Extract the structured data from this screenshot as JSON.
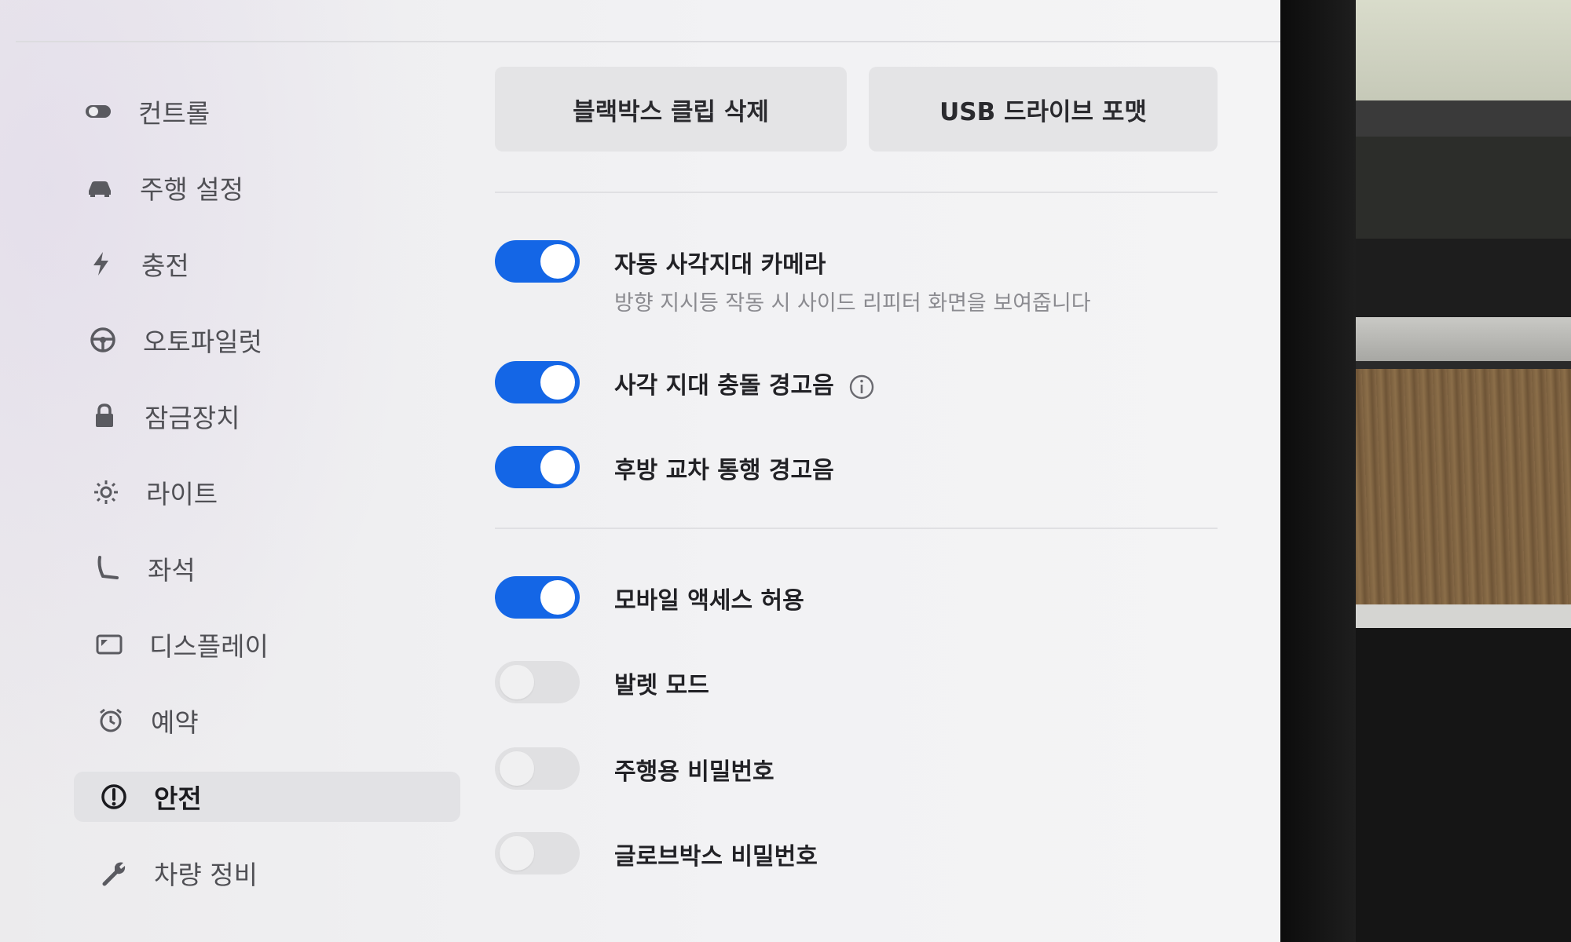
{
  "sidebar": {
    "items": [
      {
        "label": "컨트롤",
        "icon": "toggle-icon"
      },
      {
        "label": "주행 설정",
        "icon": "car-icon"
      },
      {
        "label": "충전",
        "icon": "lightning-icon"
      },
      {
        "label": "오토파일럿",
        "icon": "steering-wheel-icon"
      },
      {
        "label": "잠금장치",
        "icon": "lock-icon"
      },
      {
        "label": "라이트",
        "icon": "light-icon"
      },
      {
        "label": "좌석",
        "icon": "seat-icon"
      },
      {
        "label": "디스플레이",
        "icon": "display-icon"
      },
      {
        "label": "예약",
        "icon": "alarm-clock-icon"
      },
      {
        "label": "안전",
        "icon": "alert-circle-icon",
        "active": true
      },
      {
        "label": "차량 정비",
        "icon": "wrench-icon"
      }
    ]
  },
  "actions": {
    "delete_clips": "블랙박스 클립 삭제",
    "format_usb": "USB 드라이브 포맷"
  },
  "settings": [
    {
      "label": "자동 사각지대 카메라",
      "description": "방향 지시등 작동 시 사이드 리피터 화면을 보여줍니다",
      "on": true
    },
    {
      "label": "사각 지대 충돌 경고음",
      "on": true,
      "info": true
    },
    {
      "label": "후방 교차 통행 경고음",
      "on": true
    },
    {
      "label": "모바일 액세스 허용",
      "on": true
    },
    {
      "label": "발렛 모드",
      "on": false
    },
    {
      "label": "주행용 비밀번호",
      "on": false
    },
    {
      "label": "글로브박스 비밀번호",
      "on": false
    }
  ],
  "colors": {
    "toggle_on": "#1466e6",
    "toggle_off": "#e0e0e2",
    "active_nav_bg": "#e2e2e5"
  }
}
